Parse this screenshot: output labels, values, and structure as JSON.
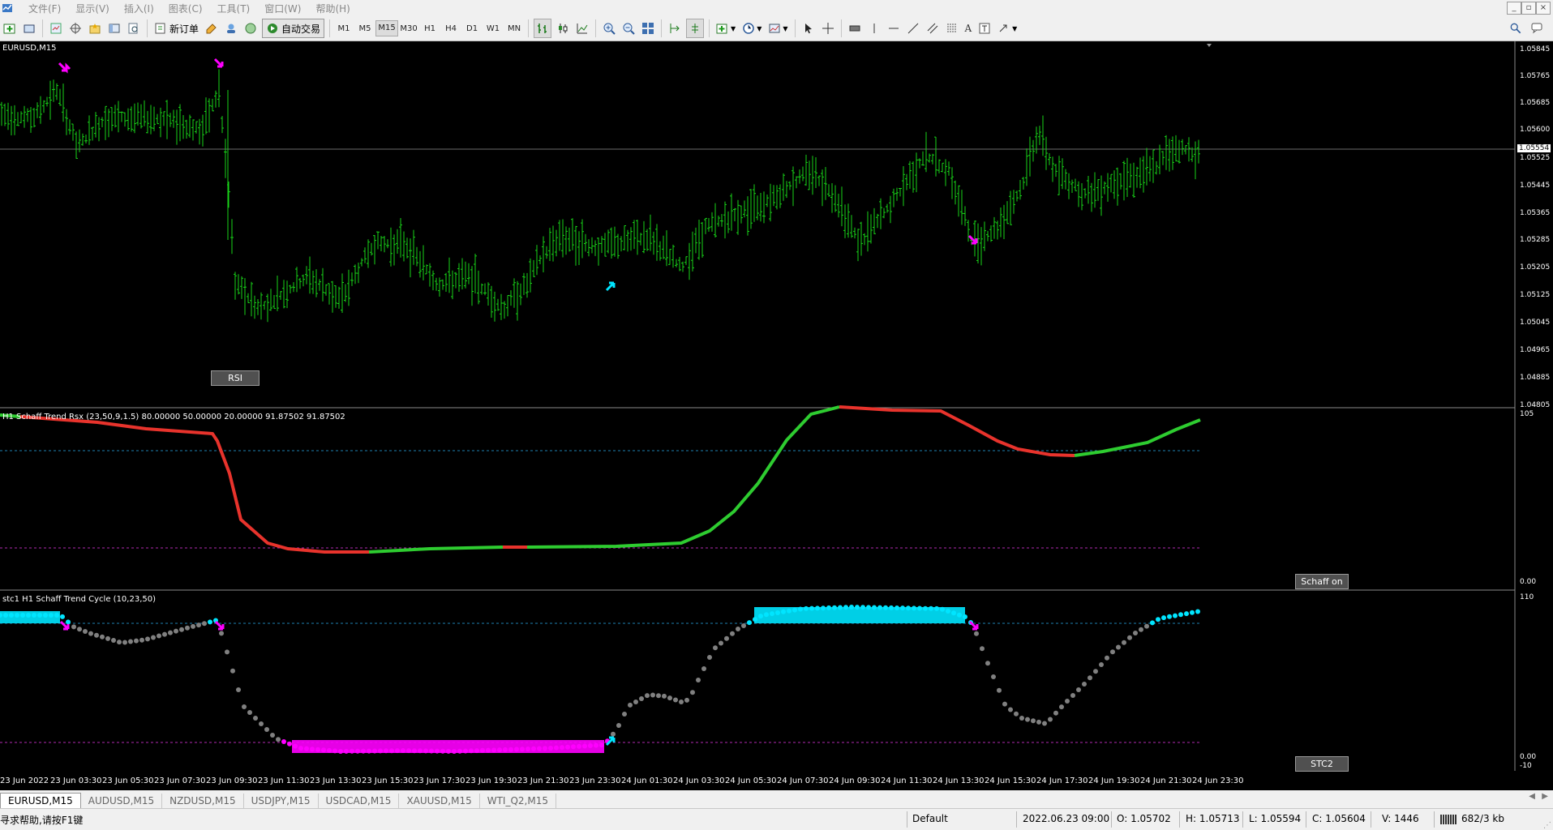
{
  "menu": [
    "文件(F)",
    "显示(V)",
    "插入(I)",
    "图表(C)",
    "工具(T)",
    "窗口(W)",
    "帮助(H)"
  ],
  "toolbar": {
    "new_order_label": "新订单",
    "auto_trading_label": "自动交易",
    "timeframes": [
      "M1",
      "M5",
      "M15",
      "M30",
      "H1",
      "H4",
      "D1",
      "W1",
      "MN"
    ],
    "active_timeframe": "M15"
  },
  "chart": {
    "symbol_label": "EURUSD,M15",
    "current_price": "1.05554",
    "price_axis": [
      "1.05845",
      "1.05765",
      "1.05685",
      "1.05600",
      "1.05525",
      "1.05445",
      "1.05365",
      "1.05285",
      "1.05205",
      "1.05125",
      "1.05045",
      "1.04965",
      "1.04885",
      "1.04805"
    ],
    "rsi_button": "RSI",
    "bar_color": "#19d419",
    "bull_arrow_color": "#00e5ff",
    "bear_arrow_color": "#ff00ff"
  },
  "indicator1": {
    "label": "H1 Schaff Trend Rsx (23,50,9,1.5) 80.00000 50.00000 20.00000 91.87502 91.87502",
    "axis_top": "105",
    "axis_bottom": "0.00",
    "button": "Schaff on",
    "up_color": "#2ecc30",
    "down_color": "#e8332c"
  },
  "indicator2": {
    "label": "stc1 H1 Schaff Trend Cycle (10,23,50)",
    "axis_top": "110",
    "axis_mid": "0.00",
    "axis_bottom": "-10",
    "button": "STC2",
    "high_color": "#00e5ff",
    "low_color": "#ff00ff",
    "neutral_color": "#808080"
  },
  "time_axis": [
    "23 Jun 2022",
    "23 Jun 03:30",
    "23 Jun 05:30",
    "23 Jun 07:30",
    "23 Jun 09:30",
    "23 Jun 11:30",
    "23 Jun 13:30",
    "23 Jun 15:30",
    "23 Jun 17:30",
    "23 Jun 19:30",
    "23 Jun 21:30",
    "23 Jun 23:30",
    "24 Jun 01:30",
    "24 Jun 03:30",
    "24 Jun 05:30",
    "24 Jun 07:30",
    "24 Jun 09:30",
    "24 Jun 11:30",
    "24 Jun 13:30",
    "24 Jun 15:30",
    "24 Jun 17:30",
    "24 Jun 19:30",
    "24 Jun 21:30",
    "24 Jun 23:30"
  ],
  "tabs": [
    "EURUSD,M15",
    "AUDUSD,M15",
    "NZDUSD,M15",
    "USDJPY,M15",
    "USDCAD,M15",
    "XAUUSD,M15",
    "WTI_Q2,M15"
  ],
  "active_tab": "EURUSD,M15",
  "status": {
    "help": "寻求帮助,请按F1键",
    "profile": "Default",
    "datetime": "2022.06.23 09:00",
    "open": "O: 1.05702",
    "high": "H: 1.05713",
    "low": "L: 1.05594",
    "close": "C: 1.05604",
    "volume": "V: 1446",
    "traffic": "682/3 kb"
  }
}
